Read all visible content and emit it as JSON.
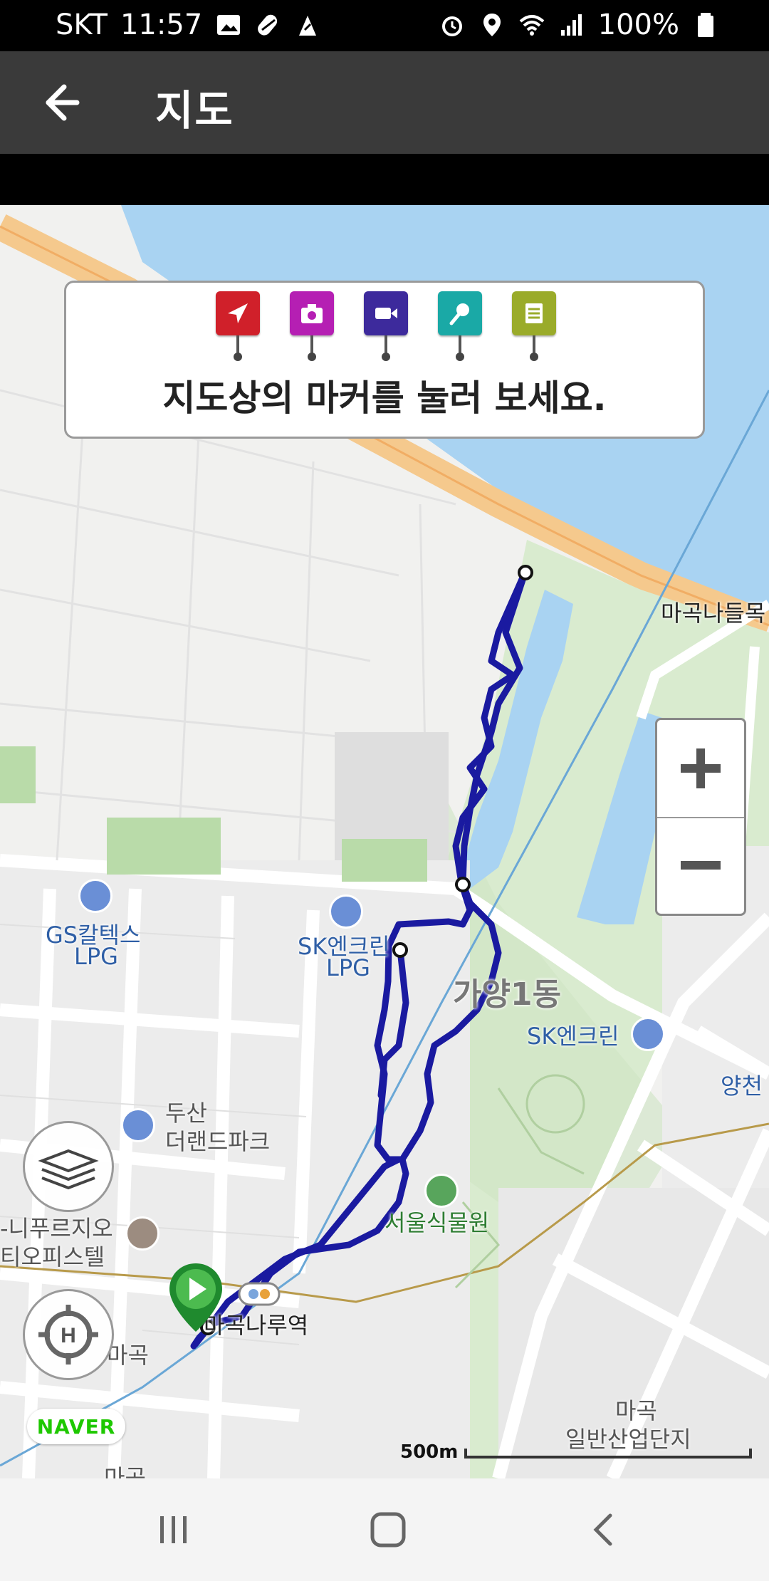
{
  "status_bar": {
    "carrier": "SKT",
    "time": "11:57",
    "battery": "100%"
  },
  "app_bar": {
    "title": "지도"
  },
  "marker_guide": {
    "text": "지도상의 마커를 눌러 보세요.",
    "markers": [
      {
        "icon": "location-arrow-icon",
        "color": "#d0202a"
      },
      {
        "icon": "camera-icon",
        "color": "#b51fb3"
      },
      {
        "icon": "video-icon",
        "color": "#3d2a9c"
      },
      {
        "icon": "microphone-icon",
        "color": "#1aa9a6"
      },
      {
        "icon": "memo-icon",
        "color": "#9aab2a"
      }
    ]
  },
  "map": {
    "labels": {
      "station_upper": "마곡나들목",
      "gs_lpg_1": "GS칼텍스",
      "gs_lpg_2": "LPG",
      "sk_lpg_1": "SK엔크린",
      "sk_lpg_2": "LPG",
      "district": "가양1동",
      "sk_station": "SK엔크린",
      "yangcheon": "양천",
      "doosan_1": "두산",
      "doosan_2": "더랜드파크",
      "officetel_1": "-니푸르지오",
      "officetel_2": "티오피스텔",
      "botanic": "서울식물원",
      "naru_station": "마곡나루역",
      "magok_small": "마곡",
      "industrial_1": "마곡",
      "industrial_2": "일반산업단지",
      "bottom_cut": "마곡"
    },
    "brand": "NAVER",
    "scale": "500m",
    "route_color": "#1a1aa0",
    "water_color": "#a9d3f2",
    "park_color": "#d9ebcf"
  },
  "nav_bar": {
    "recent": "recent-apps-icon",
    "home": "home-icon",
    "back": "back-icon"
  }
}
